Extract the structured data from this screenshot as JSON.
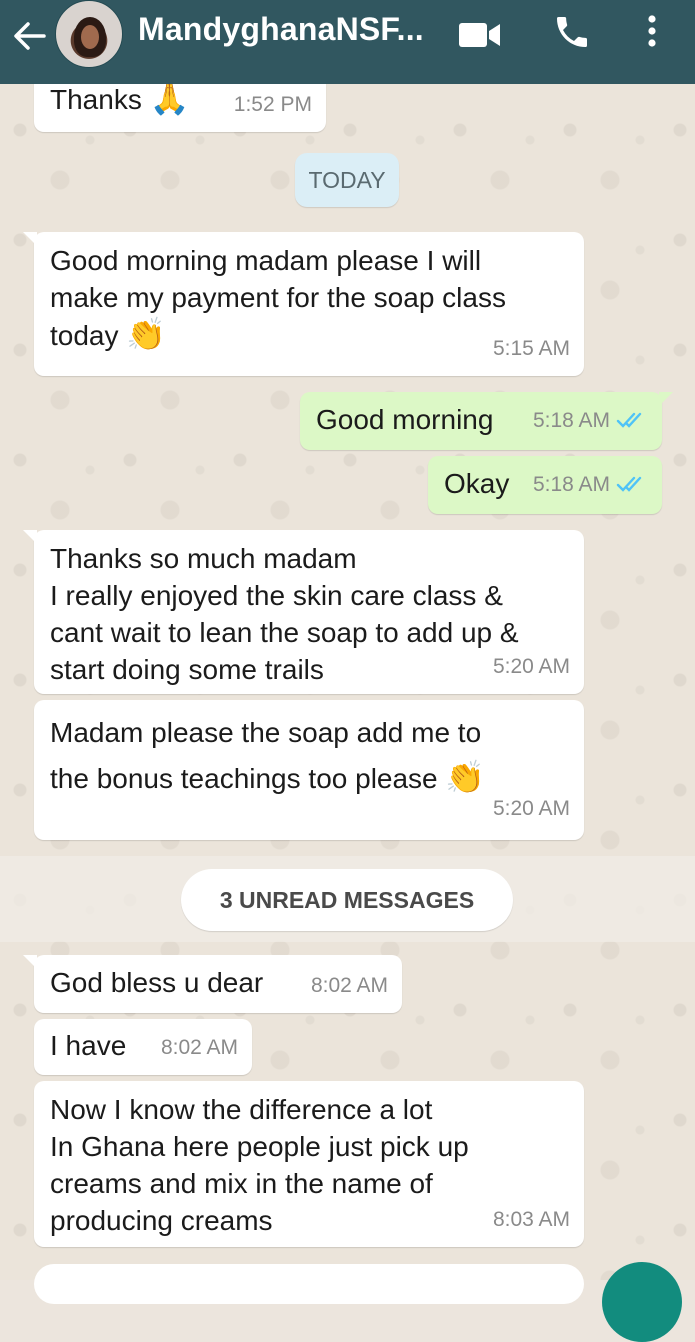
{
  "header": {
    "back_icon": "arrow-left-icon",
    "title": "MandyghanaNSF...",
    "video_icon": "video-call-icon",
    "phone_icon": "phone-icon",
    "more_icon": "more-vertical-icon",
    "bg_color": "#315760"
  },
  "date_chip": "TODAY",
  "unread_banner": "3 UNREAD MESSAGES",
  "messages": [
    {
      "dir": "in",
      "text": "Thanks",
      "emoji": "🙏",
      "time": "1:52 PM"
    },
    {
      "dir": "in",
      "text": "Good morning madam please I will\nmake my payment for the soap class\ntoday",
      "emoji": "👏",
      "time": "5:15 AM"
    },
    {
      "dir": "out",
      "text": "Good morning",
      "time": "5:18 AM",
      "status": "read"
    },
    {
      "dir": "out",
      "text": "Okay",
      "time": "5:18 AM",
      "status": "read"
    },
    {
      "dir": "in",
      "text": "Thanks so much madam\nI really enjoyed the skin care class &\ncant wait to lean the soap to add up &\nstart doing some trails",
      "time": "5:20 AM"
    },
    {
      "dir": "in",
      "text": "Madam please the soap add me to\nthe bonus teachings too please",
      "emoji": "👏",
      "time": "5:20 AM"
    },
    {
      "dir": "in",
      "text": "God bless u dear",
      "time": "8:02 AM"
    },
    {
      "dir": "in",
      "text": "I have",
      "time": "8:02 AM"
    },
    {
      "dir": "in",
      "text": "Now I know the difference a lot\nIn Ghana here people just pick up\ncreams and mix in the name of\nproducing creams",
      "time": "8:03 AM"
    }
  ],
  "colors": {
    "incoming_bubble": "#ffffff",
    "outgoing_bubble": "#dcf8c6",
    "read_tick": "#4fc3f7",
    "chat_background": "#ece5dd"
  }
}
